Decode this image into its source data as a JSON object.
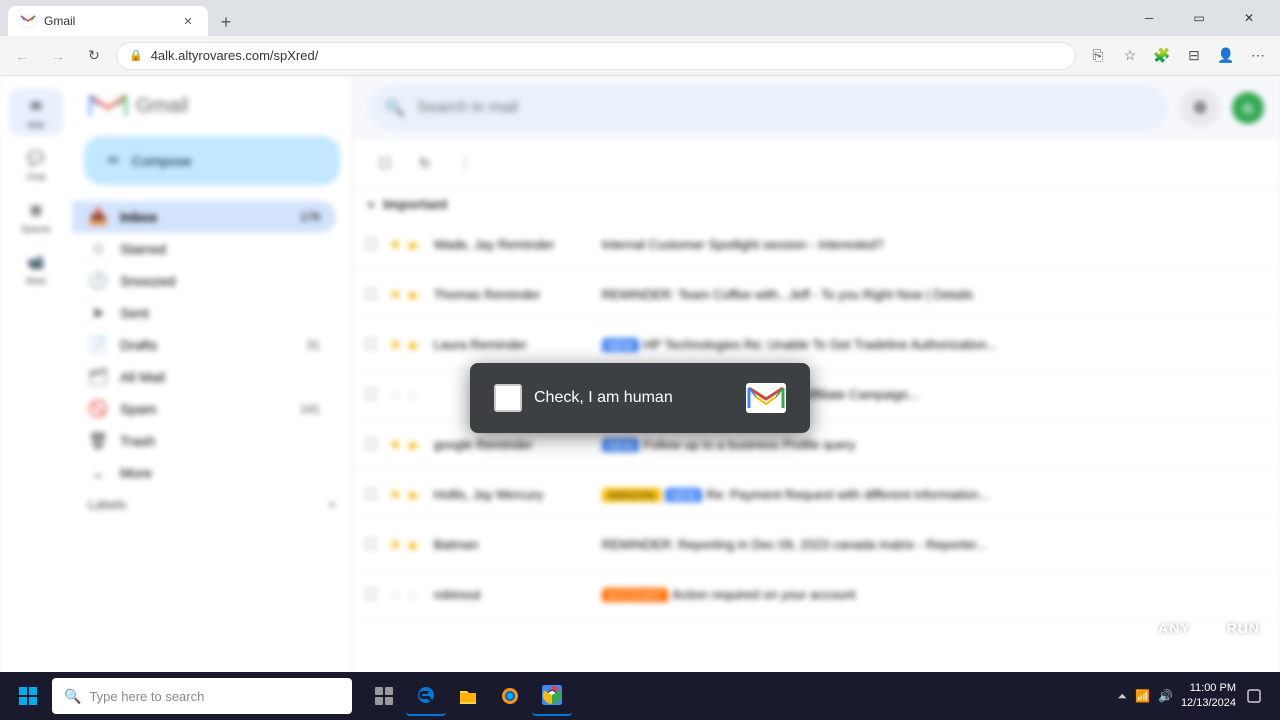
{
  "browser": {
    "tab_title": "Gmail",
    "url": "4alk.altyrovares.com/spXred/",
    "new_tab_symbol": "+",
    "back_disabled": false,
    "forward_disabled": true
  },
  "gmail": {
    "title": "Gmail",
    "search_placeholder": "Search in mail",
    "compose_label": "Compose",
    "nav_icons": [
      {
        "label": "Mail",
        "icon": "✉"
      },
      {
        "label": "Chat",
        "icon": "💬"
      },
      {
        "label": "Spaces",
        "icon": "⊞"
      },
      {
        "label": "Meet",
        "icon": "📹"
      }
    ],
    "sidebar_items": [
      {
        "label": "Inbox",
        "icon": "📥",
        "count": "178",
        "active": true
      },
      {
        "label": "Starred",
        "icon": "☆",
        "count": ""
      },
      {
        "label": "Snoozed",
        "icon": "🕐",
        "count": ""
      },
      {
        "label": "Sent",
        "icon": "➤",
        "count": ""
      },
      {
        "label": "Drafts",
        "icon": "📄",
        "count": "31"
      },
      {
        "label": "All Mail",
        "icon": "🗂",
        "count": ""
      },
      {
        "label": "Spam",
        "icon": "🚫",
        "count": "141"
      },
      {
        "label": "Trash",
        "icon": "🗑",
        "count": ""
      },
      {
        "label": "More",
        "icon": "⌄",
        "count": ""
      }
    ],
    "labels_header": "Labels",
    "section": "Important",
    "emails": [
      {
        "sender": "Wade, Jay Reminder",
        "subject": "Internal Customer Spotlight session - Interested?",
        "time": "",
        "unread": false,
        "starred": true,
        "tag": null
      },
      {
        "sender": "Thomas Reminder",
        "subject": "REMINDER: Team Coffee with...Jeff - To you Right Now | Details",
        "time": "",
        "unread": false,
        "starred": true,
        "tag": null
      },
      {
        "sender": "Laura Reminder",
        "subject": "HP Technologies Re: Unable To Get Tradeline Authorization...",
        "time": "",
        "unread": false,
        "starred": true,
        "tag": "blue"
      },
      {
        "sender": "",
        "subject": "Follow-up to new Offer: Ready For Affiliate Campaign...",
        "time": "",
        "unread": false,
        "starred": false,
        "tag": null
      },
      {
        "sender": "google Reminder",
        "subject": "Follow up to a business Profile query",
        "time": "",
        "unread": false,
        "starred": true,
        "tag": "blue"
      },
      {
        "sender": "Hollis, Jay Mercury",
        "subject": "Re: Payment Request with different tag information...",
        "time": "",
        "unread": false,
        "starred": true,
        "tag": "highlight"
      },
      {
        "sender": "Batman",
        "subject": "REMINDER: Reporting in Dec 09, 2023 canada matrix - Reporter...",
        "time": "",
        "unread": false,
        "starred": true,
        "tag": null
      },
      {
        "sender": "robinout",
        "subject": "Action required on your account",
        "time": "",
        "unread": false,
        "starred": false,
        "tag": "orange"
      }
    ]
  },
  "captcha": {
    "label": "Check, I am human",
    "checkbox_checked": false
  },
  "taskbar": {
    "search_placeholder": "Type here to search",
    "time": "11:00 PM",
    "date": "12/13/2024",
    "app_icons": [
      "⊞",
      "🗂",
      "📁",
      "🦊",
      "🌐"
    ]
  },
  "anyrun": {
    "brand": "ANY RUN"
  }
}
